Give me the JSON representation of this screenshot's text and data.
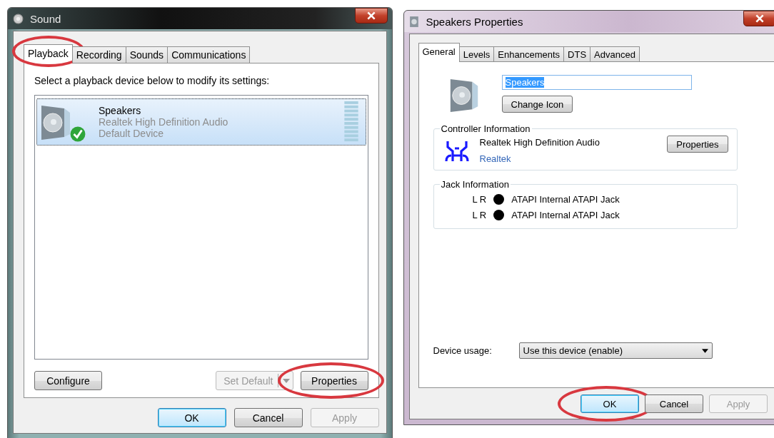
{
  "sound_window": {
    "title": "Sound",
    "tabs": [
      {
        "label": "Playback",
        "selected": true,
        "circled": true
      },
      {
        "label": "Recording",
        "selected": false,
        "circled": false
      },
      {
        "label": "Sounds",
        "selected": false,
        "circled": false
      },
      {
        "label": "Communications",
        "selected": false,
        "circled": false
      }
    ],
    "instruction": "Select a playback device below to modify its settings:",
    "devices": [
      {
        "name": "Speakers",
        "driver": "Realtek High Definition Audio",
        "status": "Default Device",
        "selected": true,
        "is_default": true
      }
    ],
    "configure_button": {
      "label": "Configure",
      "disabled": false
    },
    "set_default_button": {
      "label": "Set Default",
      "disabled": true
    },
    "properties_button": {
      "label": "Properties",
      "circled": true
    },
    "buttons": [
      {
        "label": "OK",
        "default": true,
        "disabled": false,
        "circled": false
      },
      {
        "label": "Cancel",
        "default": false,
        "disabled": false,
        "circled": false
      },
      {
        "label": "Apply",
        "default": false,
        "disabled": true,
        "circled": false
      }
    ]
  },
  "properties_window": {
    "title": "Speakers Properties",
    "tabs": [
      {
        "label": "General",
        "selected": true
      },
      {
        "label": "Levels",
        "selected": false
      },
      {
        "label": "Enhancements",
        "selected": false
      },
      {
        "label": "DTS",
        "selected": false
      },
      {
        "label": "Advanced",
        "selected": false
      }
    ],
    "name_field": {
      "value": "Speakers",
      "text_selected": true
    },
    "change_icon_button": "Change Icon",
    "controller": {
      "title": "Controller Information",
      "name": "Realtek High Definition Audio",
      "manufacturer": "Realtek",
      "properties_button": "Properties"
    },
    "jack": {
      "title": "Jack Information",
      "jacks": [
        {
          "channels": "L R",
          "color": "#000000",
          "label": "ATAPI Internal ATAPI Jack"
        },
        {
          "channels": "L R",
          "color": "#000000",
          "label": "ATAPI Internal ATAPI Jack"
        }
      ]
    },
    "device_usage": {
      "label": "Device usage:",
      "value": "Use this device (enable)"
    },
    "buttons": [
      {
        "label": "OK",
        "default": true,
        "disabled": false,
        "circled": true
      },
      {
        "label": "Cancel",
        "default": false,
        "disabled": false,
        "circled": false
      },
      {
        "label": "Apply",
        "default": false,
        "disabled": true,
        "circled": false
      }
    ]
  }
}
